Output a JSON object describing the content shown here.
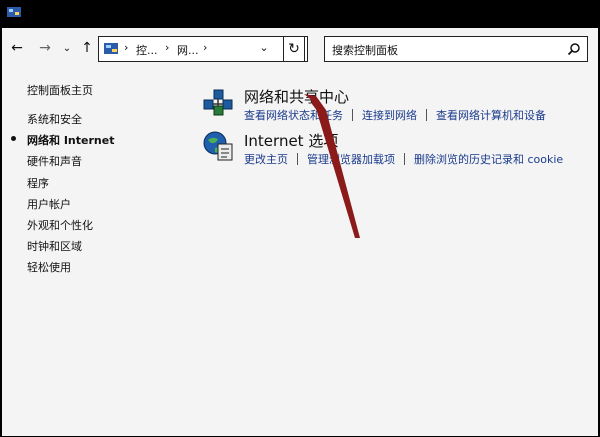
{
  "address": {
    "crumbs": [
      "控...",
      "网..."
    ],
    "separator": "›",
    "dropdown": "⌄"
  },
  "nav": {
    "back": "←",
    "forward": "→",
    "recent": "⌄",
    "up": "↑",
    "refresh": "↻"
  },
  "search": {
    "placeholder": "搜索控制面板"
  },
  "sidebar": {
    "home": "控制面板主页",
    "items": [
      {
        "label": "系统和安全"
      },
      {
        "label": "网络和 Internet",
        "active": true
      },
      {
        "label": "硬件和声音"
      },
      {
        "label": "程序"
      },
      {
        "label": "用户帐户"
      },
      {
        "label": "外观和个性化"
      },
      {
        "label": "时钟和区域"
      },
      {
        "label": "轻松使用"
      }
    ]
  },
  "sections": [
    {
      "title": "网络和共享中心",
      "icon": "network-sharing-icon",
      "links": [
        "查看网络状态和任务",
        "连接到网络",
        "查看网络计算机和设备"
      ]
    },
    {
      "title": "Internet 选项",
      "icon": "internet-options-icon",
      "links": [
        "更改主页",
        "管理浏览器加载项",
        "删除浏览的历史记录和 cookie"
      ]
    }
  ],
  "annotation": {
    "arrow_color": "#8b1a1a"
  }
}
